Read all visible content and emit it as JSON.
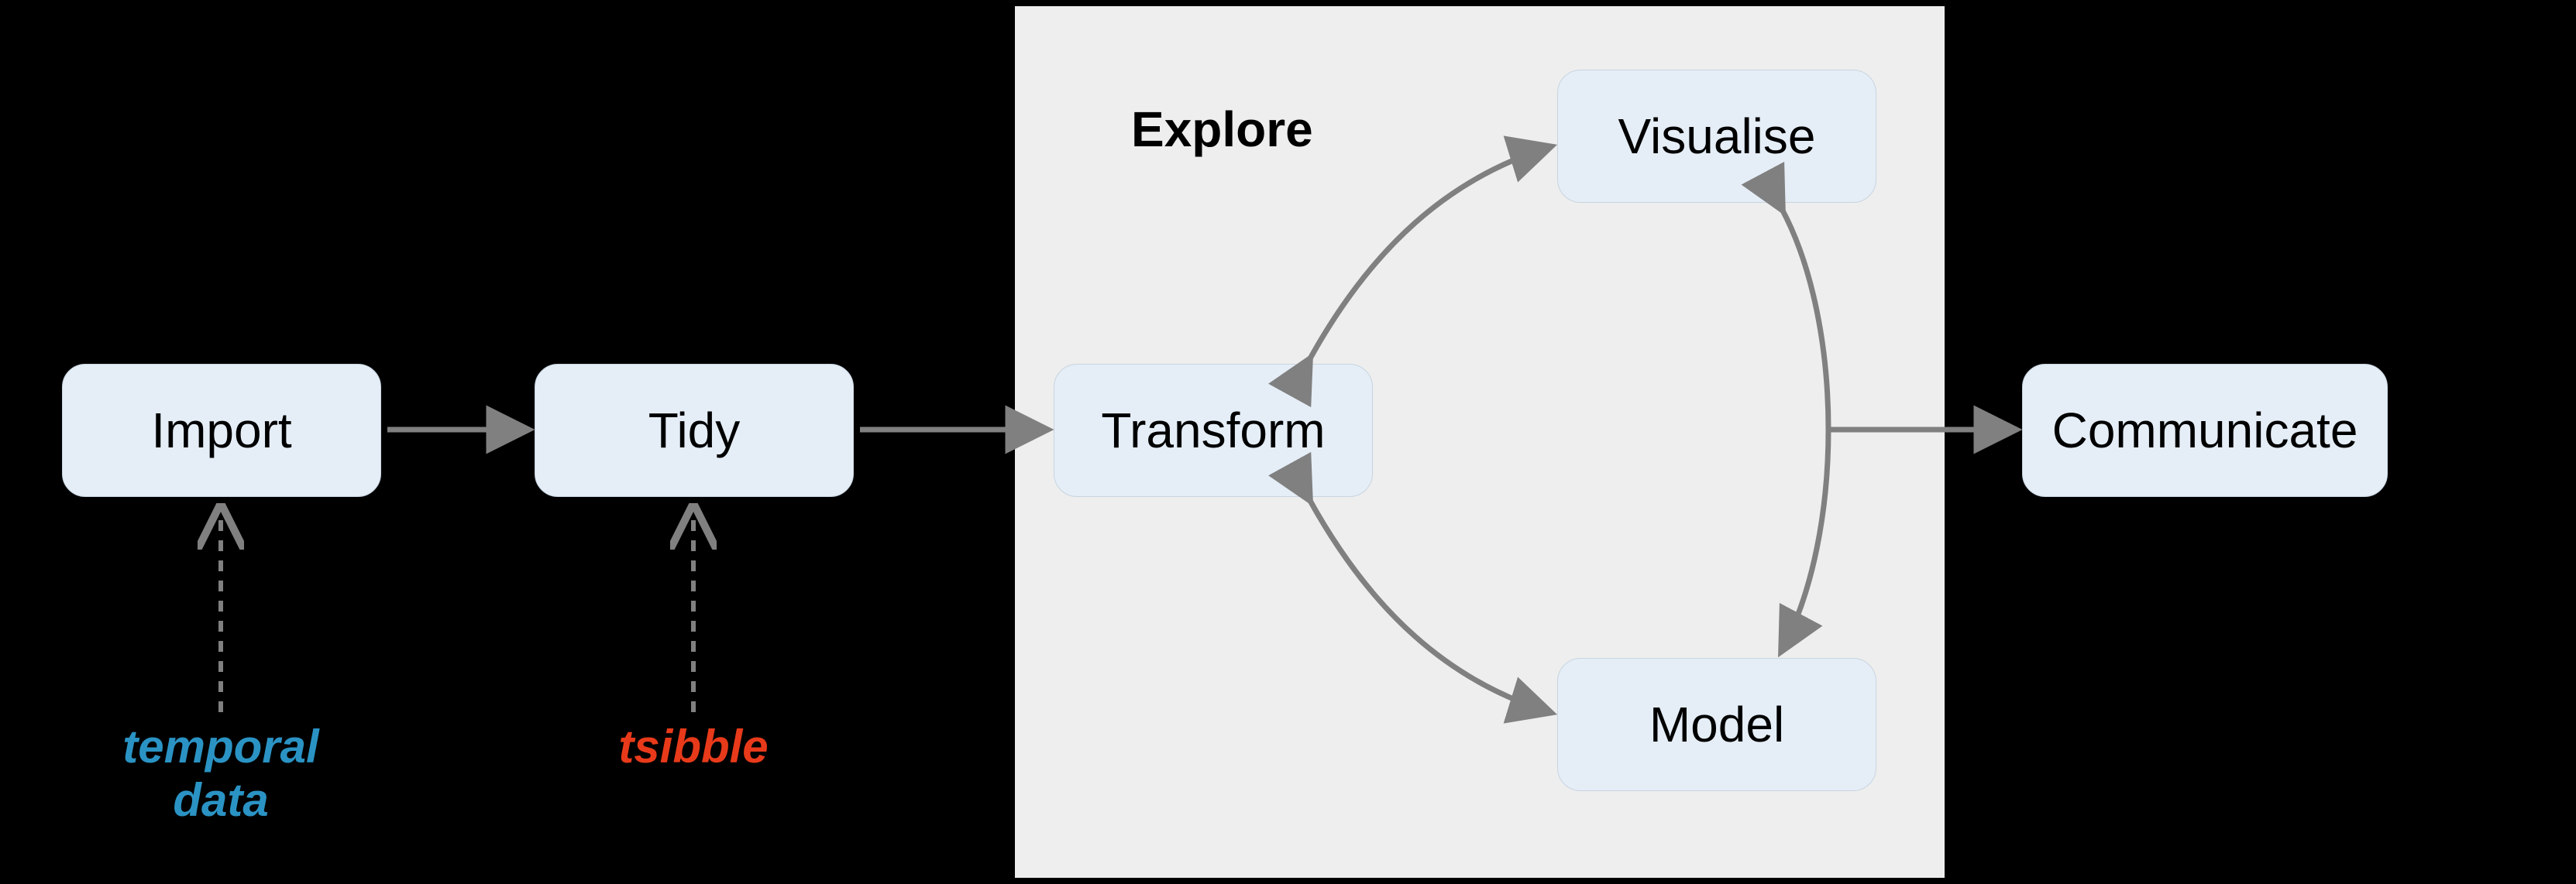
{
  "nodes": {
    "import": "Import",
    "tidy": "Tidy",
    "transform": "Transform",
    "visualise": "Visualise",
    "model": "Model",
    "communicate": "Communicate"
  },
  "sections": {
    "explore": "Explore"
  },
  "annotations": {
    "temporal_data_line1": "temporal",
    "temporal_data_line2": "data",
    "tsibble": "tsibble"
  },
  "colors": {
    "node_fill": "#e5eef7",
    "arrow": "#808080",
    "annot_teal": "#2a93c4",
    "annot_red": "#e83a1a",
    "explore_panel": "#eeeeee"
  }
}
